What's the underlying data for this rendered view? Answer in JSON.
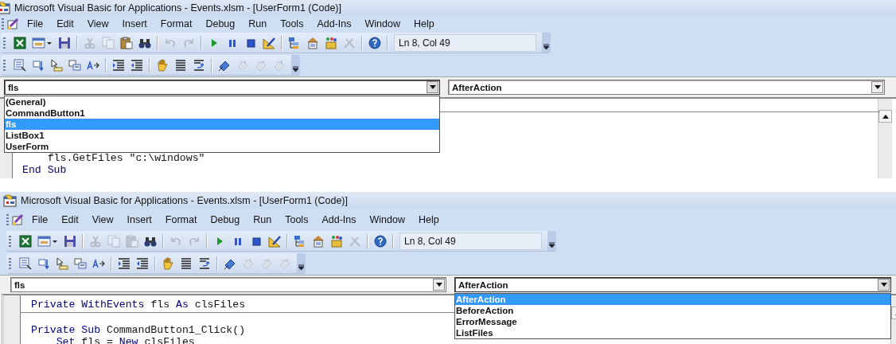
{
  "panels": [
    {
      "window": {
        "title": "Microsoft Visual Basic for Applications - Events.xlsm - [UserForm1 (Code)]"
      },
      "menu": [
        {
          "label": "File"
        },
        {
          "label": "Edit"
        },
        {
          "label": "View"
        },
        {
          "label": "Insert"
        },
        {
          "label": "Format"
        },
        {
          "label": "Debug"
        },
        {
          "label": "Run"
        },
        {
          "label": "Tools"
        },
        {
          "label": "Add-Ins"
        },
        {
          "label": "Window"
        },
        {
          "label": "Help"
        }
      ],
      "toolbars": [
        {
          "groups": [
            [
              {
                "disabled": false
              },
              {
                "disabled": false
              },
              {
                "disabled": false
              }
            ],
            [
              {
                "disabled": true
              },
              {
                "disabled": true
              },
              {
                "disabled": false
              },
              {
                "disabled": false
              }
            ],
            [
              {
                "disabled": true
              },
              {
                "disabled": true
              }
            ],
            [
              {
                "disabled": false
              },
              {
                "disabled": false
              },
              {
                "disabled": false
              },
              {
                "disabled": false
              }
            ],
            [
              {
                "disabled": false
              },
              {
                "disabled": false
              },
              {
                "disabled": false
              },
              {
                "disabled": true
              }
            ],
            [
              {
                "disabled": false
              }
            ]
          ]
        },
        {
          "groups": [
            [
              {
                "disabled": false
              },
              {
                "disabled": false
              },
              {
                "disabled": false
              },
              {
                "disabled": false
              },
              {
                "disabled": false
              }
            ],
            [
              {
                "disabled": false
              },
              {
                "disabled": false
              }
            ],
            [
              {
                "disabled": false
              },
              {
                "disabled": false
              },
              {
                "disabled": false
              }
            ],
            [
              {
                "disabled": false
              },
              {
                "disabled": true
              },
              {
                "disabled": true
              },
              {
                "disabled": true
              }
            ]
          ]
        }
      ],
      "position_field": {
        "value": "Ln 8, Col 49"
      },
      "object_box": {
        "value": "fls",
        "expanded": true,
        "options": [
          {
            "label": "(General)",
            "selected": false
          },
          {
            "label": "CommandButton1",
            "selected": false
          },
          {
            "label": "fls",
            "selected": true
          },
          {
            "label": "ListBox1",
            "selected": false
          },
          {
            "label": "UserForm",
            "selected": false
          }
        ]
      },
      "procedure_box": {
        "value": "AfterAction",
        "expanded": false
      },
      "code": {
        "separator_at_top": true,
        "lines": [
          {
            "blank_before": false,
            "segments": [
              {
                "text": "    fls.GetFiles \"c:\\windows\"",
                "kind": "plain"
              }
            ]
          },
          {
            "blank_before": false,
            "segments": [
              {
                "text": "End Sub",
                "kind": "keyword"
              }
            ]
          }
        ]
      }
    },
    {
      "window": {
        "title": "Microsoft Visual Basic for Applications - Events.xlsm - [UserForm1 (Code)]"
      },
      "menu": [
        {
          "label": "File"
        },
        {
          "label": "Edit"
        },
        {
          "label": "View"
        },
        {
          "label": "Insert"
        },
        {
          "label": "Format"
        },
        {
          "label": "Debug"
        },
        {
          "label": "Run"
        },
        {
          "label": "Tools"
        },
        {
          "label": "Add-Ins"
        },
        {
          "label": "Window"
        },
        {
          "label": "Help"
        }
      ],
      "toolbars": [
        {
          "groups": [
            [
              {
                "disabled": false
              },
              {
                "disabled": false
              },
              {
                "disabled": false
              }
            ],
            [
              {
                "disabled": true
              },
              {
                "disabled": true
              },
              {
                "disabled": true
              },
              {
                "disabled": false
              }
            ],
            [
              {
                "disabled": true
              },
              {
                "disabled": true
              }
            ],
            [
              {
                "disabled": false
              },
              {
                "disabled": false
              },
              {
                "disabled": false
              },
              {
                "disabled": false
              }
            ],
            [
              {
                "disabled": false
              },
              {
                "disabled": false
              },
              {
                "disabled": false
              },
              {
                "disabled": true
              }
            ],
            [
              {
                "disabled": false
              }
            ]
          ]
        },
        {
          "groups": [
            [
              {
                "disabled": false
              },
              {
                "disabled": false
              },
              {
                "disabled": false
              },
              {
                "disabled": false
              },
              {
                "disabled": false
              }
            ],
            [
              {
                "disabled": false
              },
              {
                "disabled": false
              }
            ],
            [
              {
                "disabled": false
              },
              {
                "disabled": false
              },
              {
                "disabled": false
              }
            ],
            [
              {
                "disabled": false
              },
              {
                "disabled": true
              },
              {
                "disabled": true
              },
              {
                "disabled": true
              }
            ]
          ]
        }
      ],
      "position_field": {
        "value": "Ln 8, Col 49"
      },
      "object_box": {
        "value": "fls",
        "expanded": false
      },
      "procedure_box": {
        "value": "AfterAction",
        "expanded": true,
        "options": [
          {
            "label": "AfterAction",
            "selected": true
          },
          {
            "label": "BeforeAction",
            "selected": false
          },
          {
            "label": "ErrorMessage",
            "selected": false
          },
          {
            "label": "ListFiles",
            "selected": false
          }
        ]
      },
      "code": {
        "separator_at_top": false,
        "lines": [
          {
            "blank_before": false,
            "segments": [
              {
                "text": "Private WithEvents ",
                "kind": "keyword"
              },
              {
                "text": "fls ",
                "kind": "plain"
              },
              {
                "text": "As ",
                "kind": "keyword"
              },
              {
                "text": "clsFiles",
                "kind": "plain"
              }
            ]
          },
          {
            "blank_before": true,
            "segments": [
              {
                "text": "Private Sub ",
                "kind": "keyword"
              },
              {
                "text": "CommandButton1_Click()",
                "kind": "plain"
              }
            ]
          },
          {
            "blank_before": false,
            "segments": [
              {
                "text": "    Set ",
                "kind": "keyword"
              },
              {
                "text": "fls = ",
                "kind": "plain"
              },
              {
                "text": "New ",
                "kind": "keyword"
              },
              {
                "text": "clsFiles",
                "kind": "plain"
              }
            ]
          }
        ]
      }
    }
  ]
}
